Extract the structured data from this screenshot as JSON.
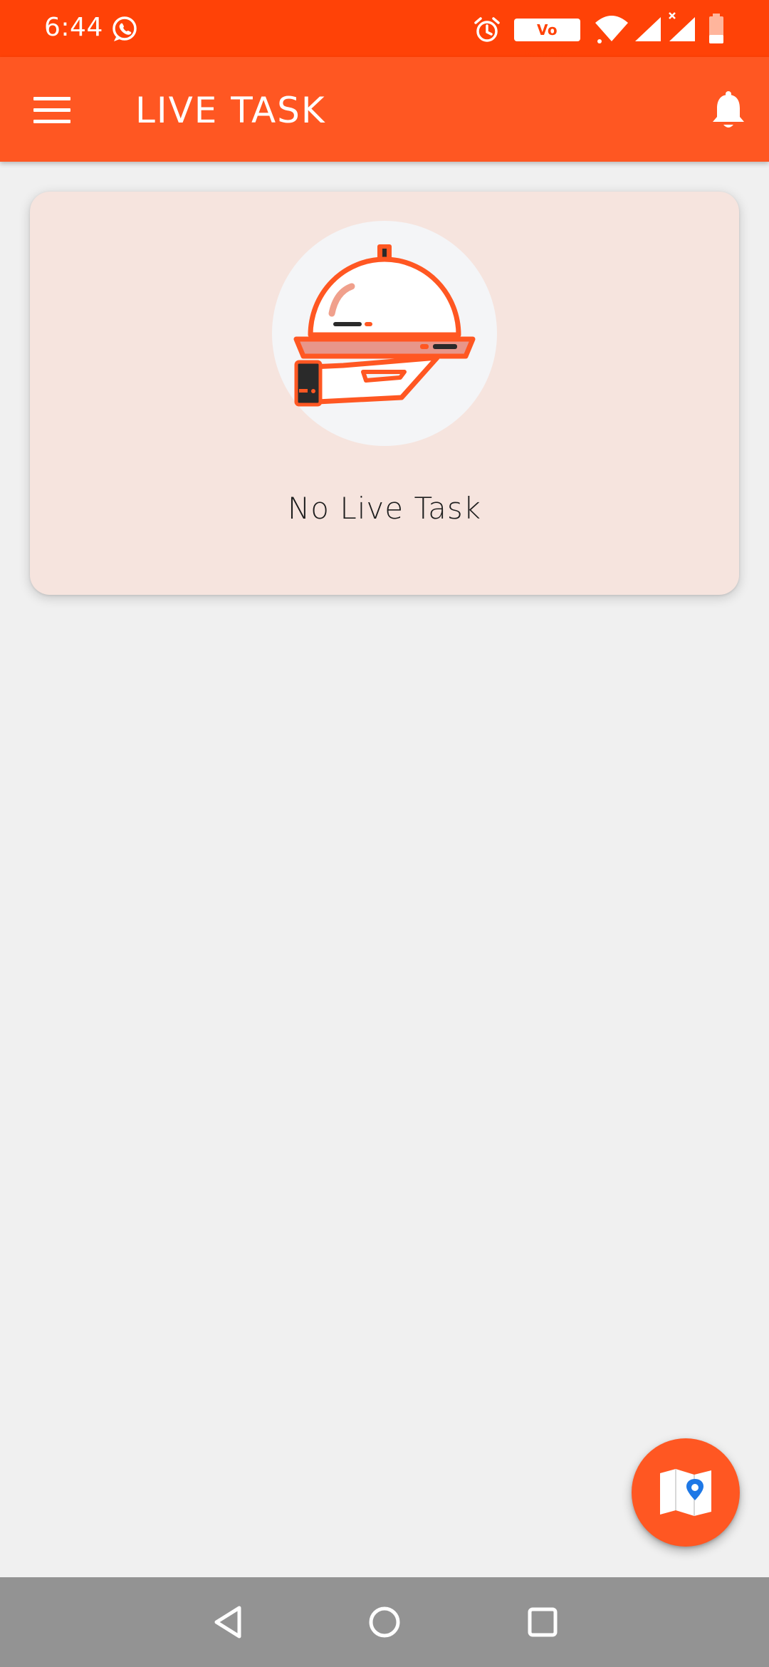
{
  "status_bar": {
    "time": "6:44",
    "vowifi_label": "Vo WiFi2",
    "icons": [
      "whatsapp-icon",
      "alarm-icon",
      "vowifi-icon",
      "wifi-icon",
      "signal-icon",
      "signal-x-icon",
      "battery-icon"
    ],
    "battery_level": 0.3
  },
  "app_bar": {
    "title": "LIVE TASK",
    "menu_icon": "menu-icon",
    "bell_icon": "bell-icon"
  },
  "card": {
    "illustration": "serving-tray-icon",
    "message": "No Live Task"
  },
  "fab": {
    "icon": "map-pin-icon"
  },
  "nav_bar": {
    "buttons": [
      "back-icon",
      "home-icon",
      "recents-icon"
    ]
  },
  "colors": {
    "status_bar": "#ff4207",
    "app_bar": "#ff5722",
    "card_bg": "#f6e4de",
    "page_bg": "#f0f0f0",
    "nav_bar": "#939393",
    "map_pin": "#1e78e6"
  }
}
